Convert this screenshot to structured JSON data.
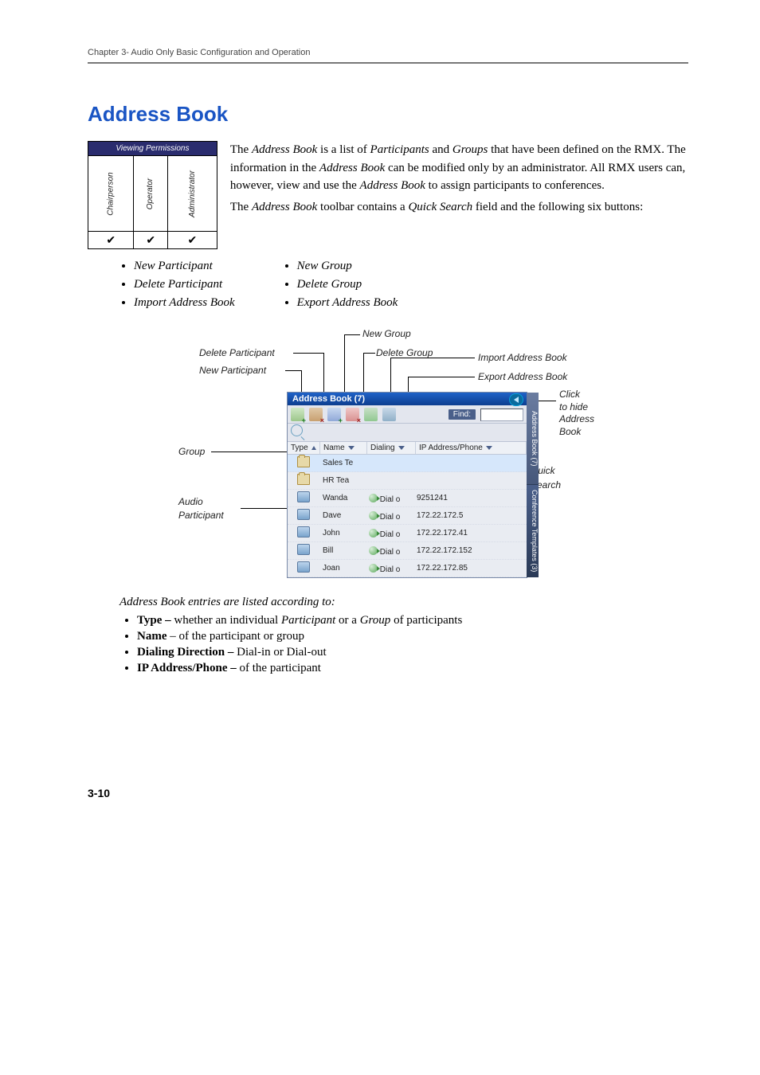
{
  "chapter_head": "Chapter 3- Audio Only Basic Configuration and Operation",
  "section_title": "Address Book",
  "permissions": {
    "title": "Viewing Permissions",
    "roles": [
      "Chairperson",
      "Operator",
      "Administrator"
    ],
    "checks": [
      "✔",
      "✔",
      "✔"
    ]
  },
  "intro": {
    "p1a": "The ",
    "p1b": "Address Book",
    "p1c": " is a list of ",
    "p1d": "Participants",
    "p1e": " and ",
    "p1f": "Groups",
    "p1g": " that have been defined on the RMX. The information in the ",
    "p1h": "Address Book",
    "p1i": " can be modified only by an administrator. All RMX users can, however, view and use the ",
    "p1j": "Address Book",
    "p1k": " to assign participants to conferences.",
    "p2a": "The ",
    "p2b": "Address Book",
    "p2c": " toolbar contains a ",
    "p2d": "Quick Search",
    "p2e": " field and the following six buttons:"
  },
  "buttons_left": [
    "New Participant",
    "Delete Participant",
    "Import Address Book"
  ],
  "buttons_right": [
    "New Group",
    "Delete Group",
    "Export Address Book"
  ],
  "callouts": {
    "new_group": "New Group",
    "delete_participant": "Delete Participant",
    "delete_group": "Delete Group",
    "new_participant": "New Participant",
    "import_ab": "Import Address Book",
    "export_ab": "Export Address Book",
    "click_hide_l1": "Click",
    "click_hide_l2": "to hide",
    "click_hide_l3": "Address",
    "click_hide_l4": "Book",
    "group": "Group",
    "quick": "Quick",
    "search": "Search",
    "audio_l1": "Audio",
    "audio_l2": "Participant"
  },
  "pane": {
    "title": "Address Book (7)",
    "find_label": "Find:",
    "columns": {
      "type": "Type",
      "name": "Name",
      "dialing": "Dialing",
      "ip": "IP Address/Phone"
    },
    "rows": [
      {
        "kind": "group",
        "name": "Sales Te",
        "dial": "",
        "ip": "",
        "selected": true
      },
      {
        "kind": "group",
        "name": "HR Tea",
        "dial": "",
        "ip": ""
      },
      {
        "kind": "part",
        "name": "Wanda",
        "dial": "Dial o",
        "ip": "9251241"
      },
      {
        "kind": "part",
        "name": "Dave",
        "dial": "Dial o",
        "ip": "172.22.172.5"
      },
      {
        "kind": "part",
        "name": "John",
        "dial": "Dial o",
        "ip": "172.22.172.41"
      },
      {
        "kind": "part",
        "name": "Bill",
        "dial": "Dial o",
        "ip": "172.22.172.152"
      },
      {
        "kind": "part",
        "name": "Joan",
        "dial": "Dial o",
        "ip": "172.22.172.85"
      }
    ],
    "side_tabs": [
      "Address Book (7)",
      "Conference Templates (3)"
    ]
  },
  "after": {
    "lead_a": "Address Book",
    "lead_b": " entries are listed according to:",
    "items": [
      {
        "bold": "Type – ",
        "mid_a": "whether an individual ",
        "it_a": "Participant",
        "mid_b": " or a ",
        "it_b": "Group",
        "tail": " of participants"
      },
      {
        "bold": "Name",
        "tail": " – of the participant or group"
      },
      {
        "bold": "Dialing Direction – ",
        "tail": "Dial-in or Dial-out"
      },
      {
        "bold": "IP Address/Phone – ",
        "tail": "of the participant"
      }
    ]
  },
  "page_number": "3-10"
}
